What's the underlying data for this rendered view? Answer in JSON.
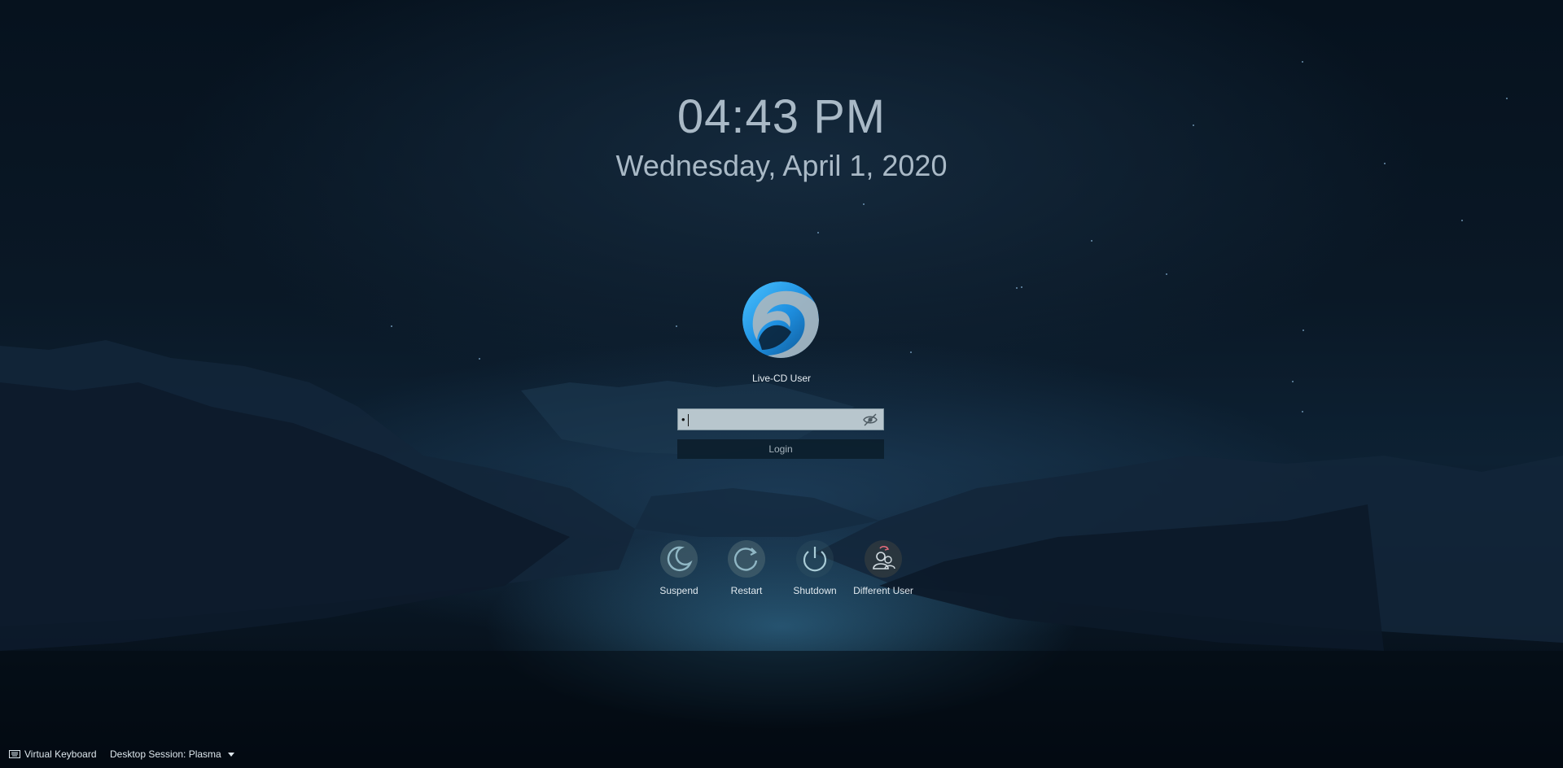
{
  "clock": {
    "time": "04:43 PM",
    "date": "Wednesday, April 1, 2020"
  },
  "user": {
    "name": "Live-CD User",
    "avatar_icon": "user-avatar-logo-icon"
  },
  "login": {
    "password_value": "•",
    "reveal_icon": "eye-slash-icon",
    "button_label": "Login"
  },
  "power_actions": [
    {
      "label": "Suspend",
      "icon": "moon-icon"
    },
    {
      "label": "Restart",
      "icon": "restart-icon"
    },
    {
      "label": "Shutdown",
      "icon": "power-icon"
    },
    {
      "label": "Different User",
      "icon": "switch-user-icon"
    }
  ],
  "footer": {
    "virtual_keyboard_label": "Virtual Keyboard",
    "session_label": "Desktop Session: Plasma"
  },
  "colors": {
    "accent": "#2a9fe6",
    "text": "#a9b9c6"
  }
}
